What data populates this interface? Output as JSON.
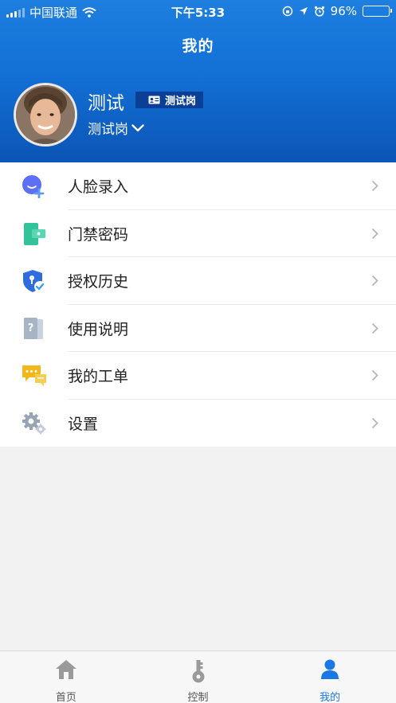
{
  "status_bar": {
    "carrier": "中国联通",
    "time": "下午5:33",
    "battery_percent": "96%",
    "battery_level": 0.96
  },
  "page": {
    "title": "我的"
  },
  "profile": {
    "name": "测试",
    "badge": "测试岗",
    "current_role": "测试岗"
  },
  "menu": {
    "items": [
      {
        "label": "人脸录入",
        "icon": "face-add-icon"
      },
      {
        "label": "门禁密码",
        "icon": "door-password-icon"
      },
      {
        "label": "授权历史",
        "icon": "shield-check-icon"
      },
      {
        "label": "使用说明",
        "icon": "help-document-icon"
      },
      {
        "label": "我的工单",
        "icon": "chat-ticket-icon"
      },
      {
        "label": "设置",
        "icon": "gear-icon"
      }
    ]
  },
  "tabbar": {
    "tabs": [
      {
        "label": "首页",
        "icon": "home-icon"
      },
      {
        "label": "控制",
        "icon": "key-icon"
      },
      {
        "label": "我的",
        "icon": "person-icon",
        "active": true
      }
    ]
  },
  "colors": {
    "header_top": "#1e7fe0",
    "header_bottom": "#0b55b6",
    "badge_bg": "#0a3f96",
    "active_tab": "#1a78e6",
    "inactive_icon": "#9a9a9a"
  }
}
